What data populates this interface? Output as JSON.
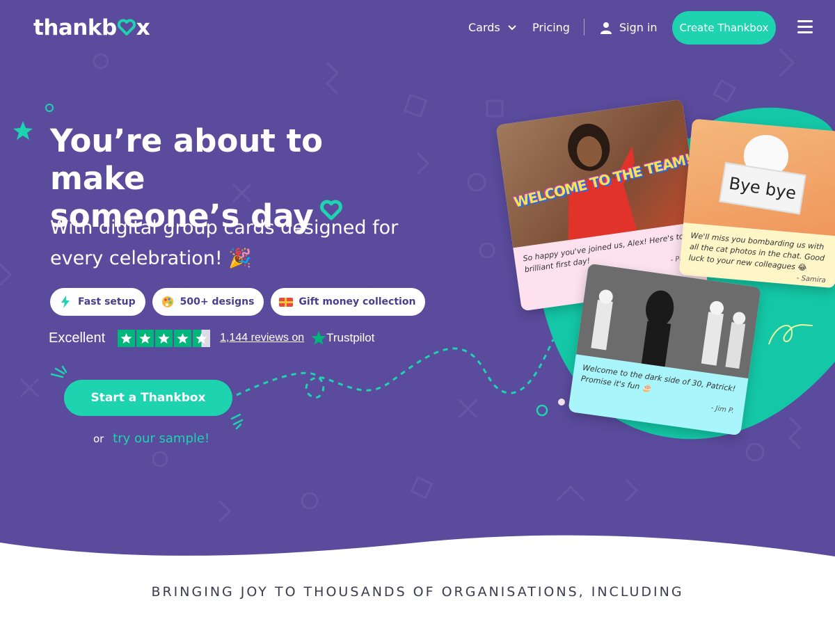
{
  "header": {
    "logo_prefix": "thankb",
    "logo_suffix": "x",
    "nav": {
      "cards": "Cards",
      "pricing": "Pricing",
      "signin": "Sign in",
      "create": "Create Thankbox"
    }
  },
  "hero": {
    "headline_line1": "You’re about to make",
    "headline_line2": "someone’s day",
    "subline_line1": "With digital group cards designed for",
    "subline_line2": "every celebration! 🎉",
    "pills": [
      {
        "label": "Fast setup",
        "icon": "lightning-icon"
      },
      {
        "label": "500+ designs",
        "icon": "palette-icon"
      },
      {
        "label": "Gift money collection",
        "icon": "gift-card-icon"
      }
    ],
    "trustpilot": {
      "rating_word": "Excellent",
      "stars": 4.5,
      "reviews": "1,144 reviews on",
      "brand": "Trustpilot"
    },
    "cta": "Start a Thankbox",
    "or": "or",
    "sample": "try our sample!"
  },
  "cards": [
    {
      "image_text": "WELCOME TO THE TEAM!",
      "message": "So happy you've joined us, Alex! Here's to a brilliant first day!",
      "signature": "- Paula"
    },
    {
      "image_text": "Bye bye",
      "message": "We'll miss you bombarding us with all the cat photos in the chat. Good luck to your new colleagues 😂",
      "signature": "- Samira"
    },
    {
      "message": "Welcome to the dark side of 30, Patrick! Promise it's fun 🎂",
      "signature": "- Jim P."
    }
  ],
  "tagline": "BRINGING JOY TO THOUSANDS OF ORGANISATIONS, INCLUDING",
  "colors": {
    "hero_bg": "#5a4b9c",
    "accent": "#1dd3b0",
    "pill_text": "#4a3d8c",
    "trustpilot_green": "#00b67a"
  }
}
